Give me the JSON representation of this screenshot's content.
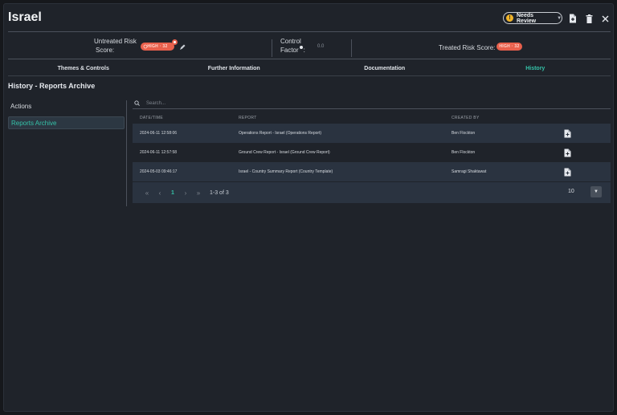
{
  "header": {
    "title": "Israel",
    "status": "Needs Review",
    "status_icon": "exclamation-icon"
  },
  "scores": {
    "untreated_label_1": "Untreated Risk",
    "untreated_label_2": "Score:",
    "untreated_badge": "HIGH · 32",
    "control_label_1": "Control",
    "control_label_2": "Factor",
    "control_colon": ":",
    "control_value": "0.0",
    "treated_label": "Treated Risk Score:",
    "treated_badge": "HIGH · 32"
  },
  "tabs": [
    {
      "label": "Themes & Controls"
    },
    {
      "label": "Further Information"
    },
    {
      "label": "Documentation"
    },
    {
      "label": "History"
    }
  ],
  "section_title": "History - Reports Archive",
  "sidebar": {
    "items": [
      {
        "label": "Actions"
      },
      {
        "label": "Reports Archive"
      }
    ]
  },
  "search": {
    "placeholder": "Search..."
  },
  "table": {
    "headers": [
      "DATE/TIME",
      "REPORT",
      "CREATED BY"
    ],
    "rows": [
      {
        "date": "2024-06-11 12:58:06",
        "report": "Operations Report - Israel (Operations Report)",
        "created_by": "Ben Flockton"
      },
      {
        "date": "2024-06-11 12:57:58",
        "report": "Ground Crew Report - Israel (Ground Crew Report)",
        "created_by": "Ben Flockton"
      },
      {
        "date": "2024-05-03 09:46:17",
        "report": "Israel - Country Summary Report (Country Template)",
        "created_by": "Samragi Shaktawat"
      }
    ]
  },
  "pagination": {
    "first": "«",
    "prev": "‹",
    "current": "1",
    "next": "›",
    "last": "»",
    "range": "1-3 of 3",
    "page_size": "10"
  },
  "colors": {
    "accent": "#35c2a8",
    "risk_high": "#e8604c",
    "warning": "#f0b429"
  }
}
